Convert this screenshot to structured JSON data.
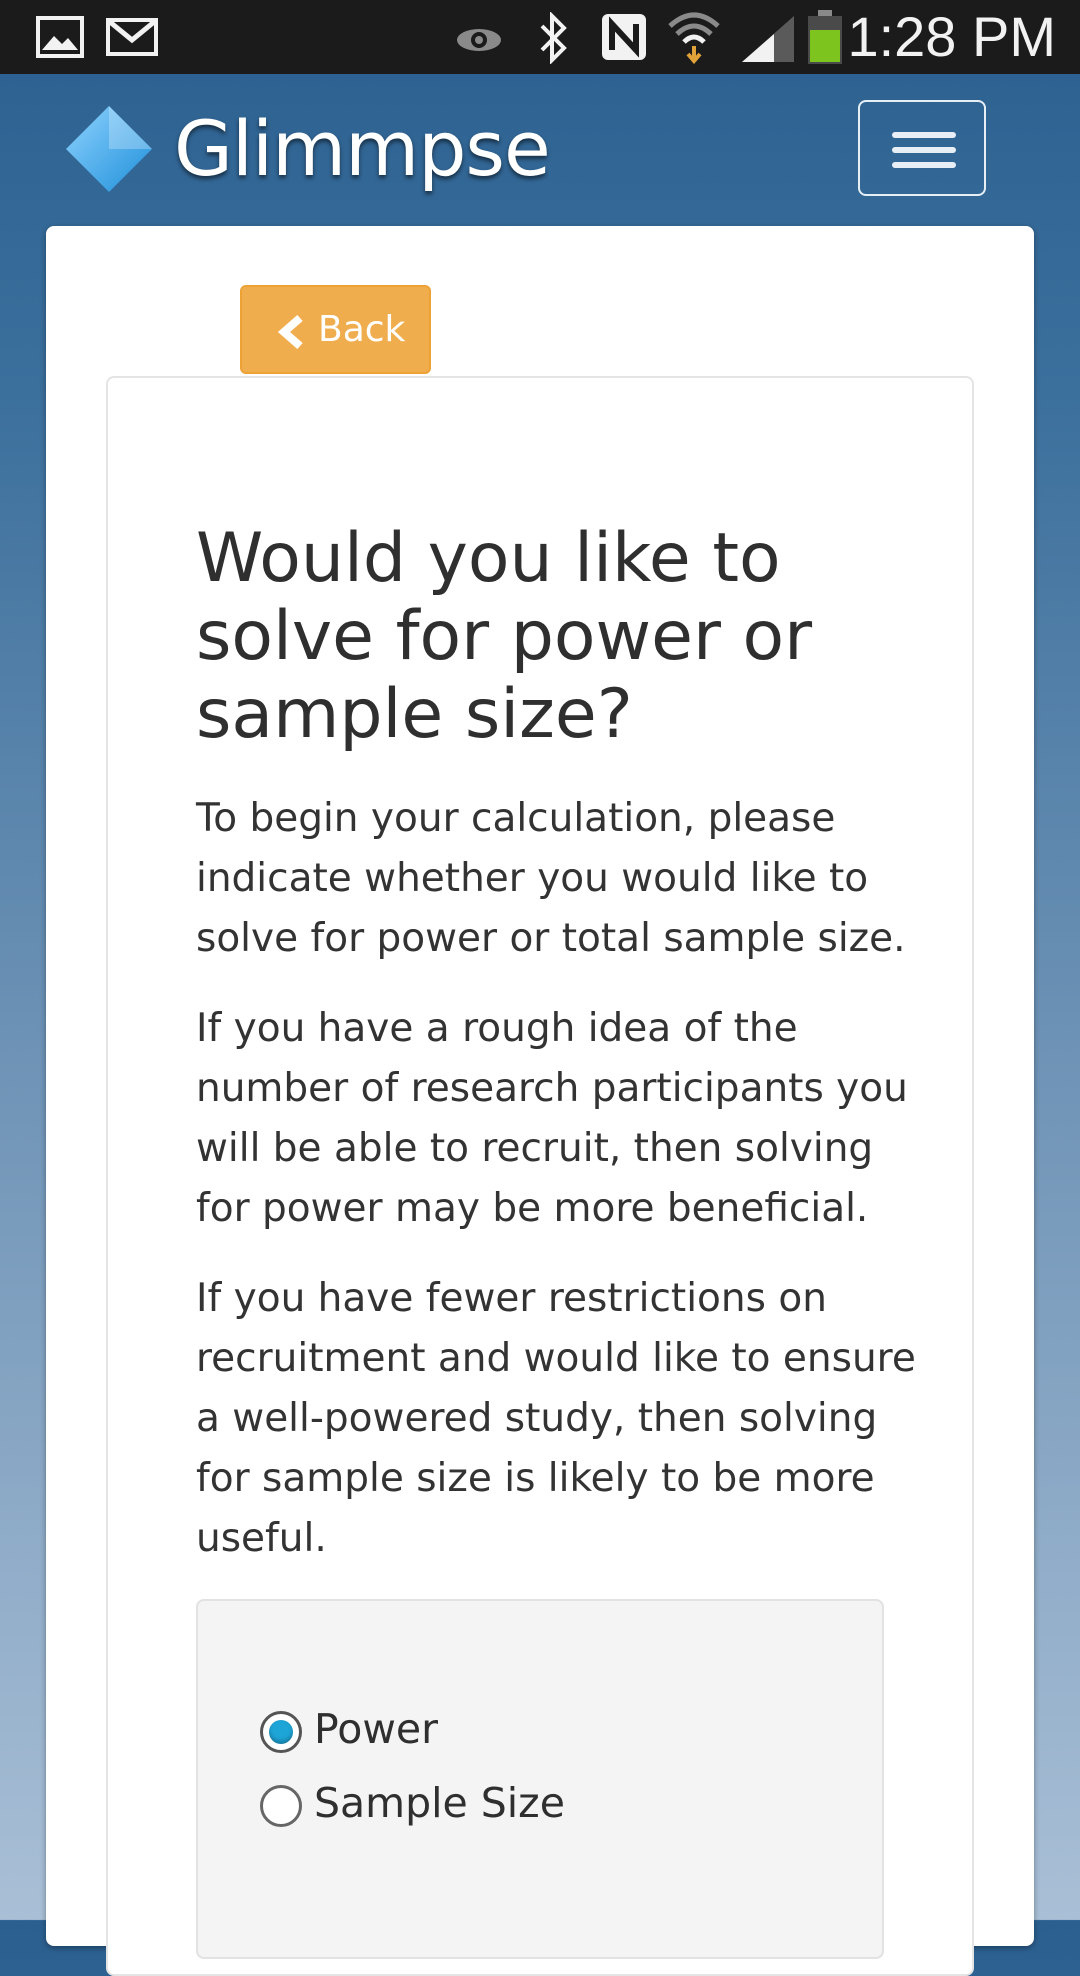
{
  "status_bar": {
    "time": "1:28 PM",
    "icons": [
      "gallery-icon",
      "gmail-icon",
      "eye-icon",
      "bluetooth-icon",
      "nfc-icon",
      "wifi-icon",
      "signal-icon",
      "battery-icon"
    ]
  },
  "header": {
    "app_name": "Glimmpse",
    "logo_color": "#3aa8e8",
    "menu_icon": "hamburger-menu-icon"
  },
  "nav": {
    "back_label": "Back",
    "back_color": "#f0ad4e"
  },
  "main": {
    "title": "Would you like to solve for power or sample size?",
    "paragraphs": [
      "To begin your calculation, please indicate whether you would like to solve for power or total sample size.",
      "If you have a rough idea of the number of research participants you will be able to recruit, then solving for power may be more beneficial.",
      "If you have fewer restrictions on recruitment and would like to ensure a well-powered study, then solving for sample size is likely to be more useful."
    ],
    "options": [
      {
        "label": "Power",
        "selected": true
      },
      {
        "label": "Sample Size",
        "selected": false
      }
    ]
  }
}
